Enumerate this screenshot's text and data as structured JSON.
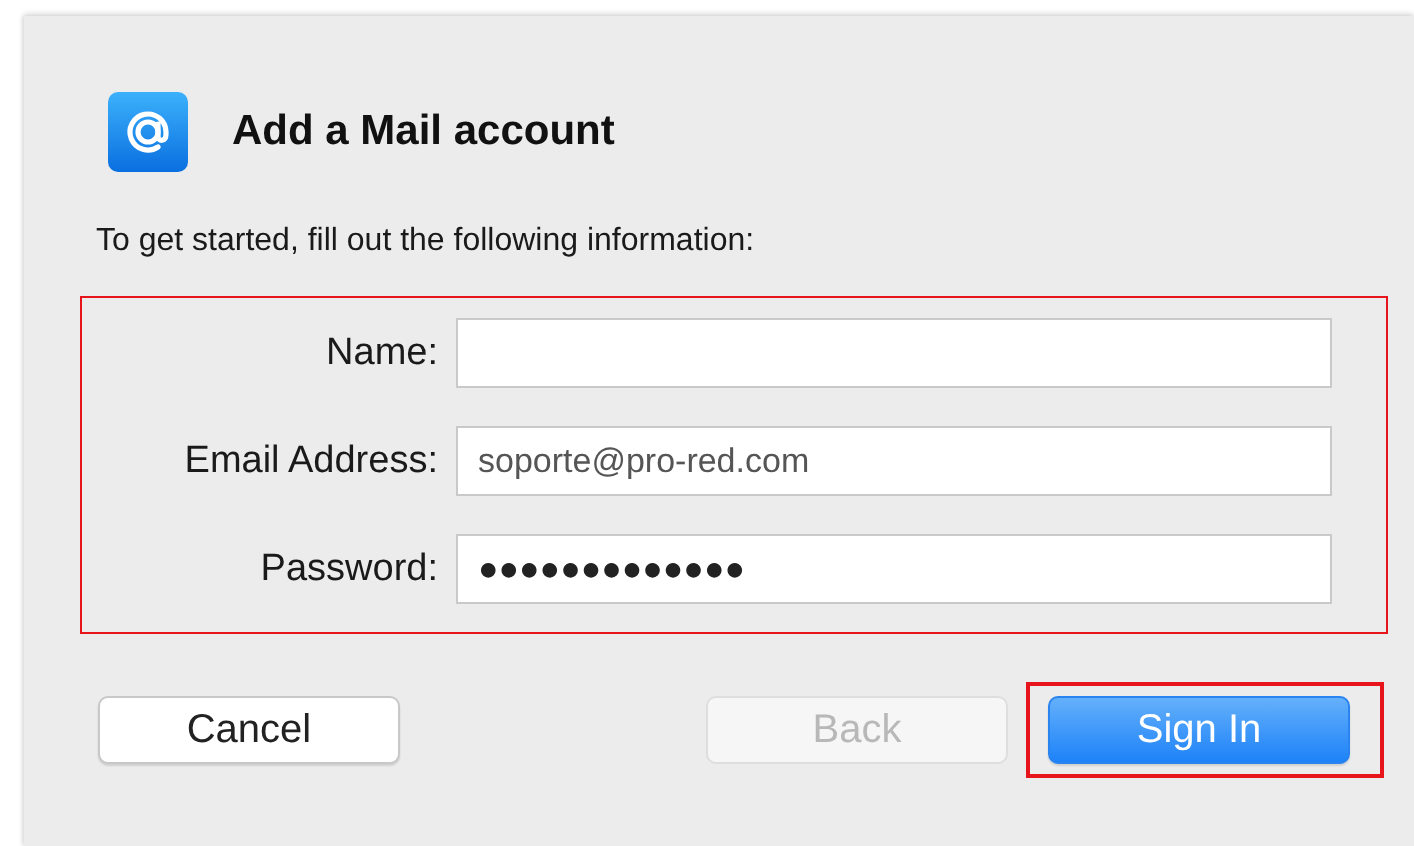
{
  "dialog": {
    "title": "Add a Mail account",
    "instruction": "To get started, fill out the following information:",
    "form": {
      "highlighted": true,
      "fields": [
        {
          "label": "Name:",
          "kind": "text"
        },
        {
          "label": "Email Address:",
          "kind": "text",
          "value": "soporte@pro-red.com"
        },
        {
          "label": "Password:",
          "kind": "password",
          "value": "●●●●●●●●●●●●●"
        }
      ]
    },
    "buttons": [
      {
        "label": "Cancel",
        "disabled": false,
        "default": false,
        "highlighted": false
      },
      {
        "label": "Back",
        "disabled": true,
        "default": false,
        "highlighted": false
      },
      {
        "label": "Sign In",
        "disabled": false,
        "default": true,
        "highlighted": true
      }
    ]
  }
}
